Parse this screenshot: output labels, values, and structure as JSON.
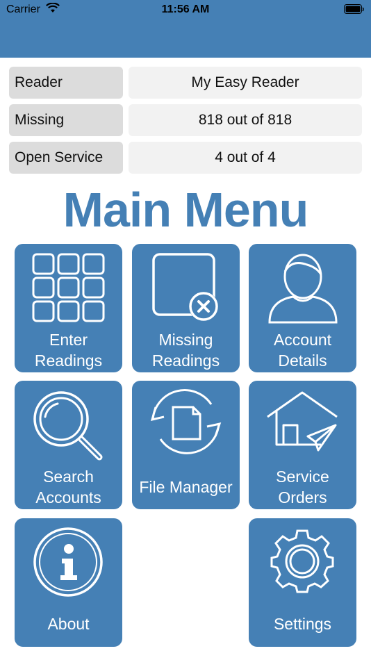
{
  "status_bar": {
    "carrier": "Carrier",
    "time": "11:56 AM"
  },
  "info": [
    {
      "label": "Reader",
      "value": "My Easy Reader"
    },
    {
      "label": "Missing",
      "value": "818 out of 818"
    },
    {
      "label": "Open Service",
      "value": "4 out of 4"
    }
  ],
  "menu": {
    "title": "Main Menu",
    "tiles": [
      {
        "line1": "Enter",
        "line2": "Readings"
      },
      {
        "line1": "Missing",
        "line2": "Readings"
      },
      {
        "line1": "Account",
        "line2": "Details"
      },
      {
        "line1": "Search",
        "line2": "Accounts"
      },
      {
        "line1": "File Manager"
      },
      {
        "line1": "Service",
        "line2": "Orders"
      },
      {
        "line1": "About"
      },
      {
        "line1": "Settings"
      }
    ]
  },
  "colors": {
    "primary": "#4580b5",
    "label_bg": "#dcdcdc",
    "value_bg": "#f2f2f2"
  }
}
